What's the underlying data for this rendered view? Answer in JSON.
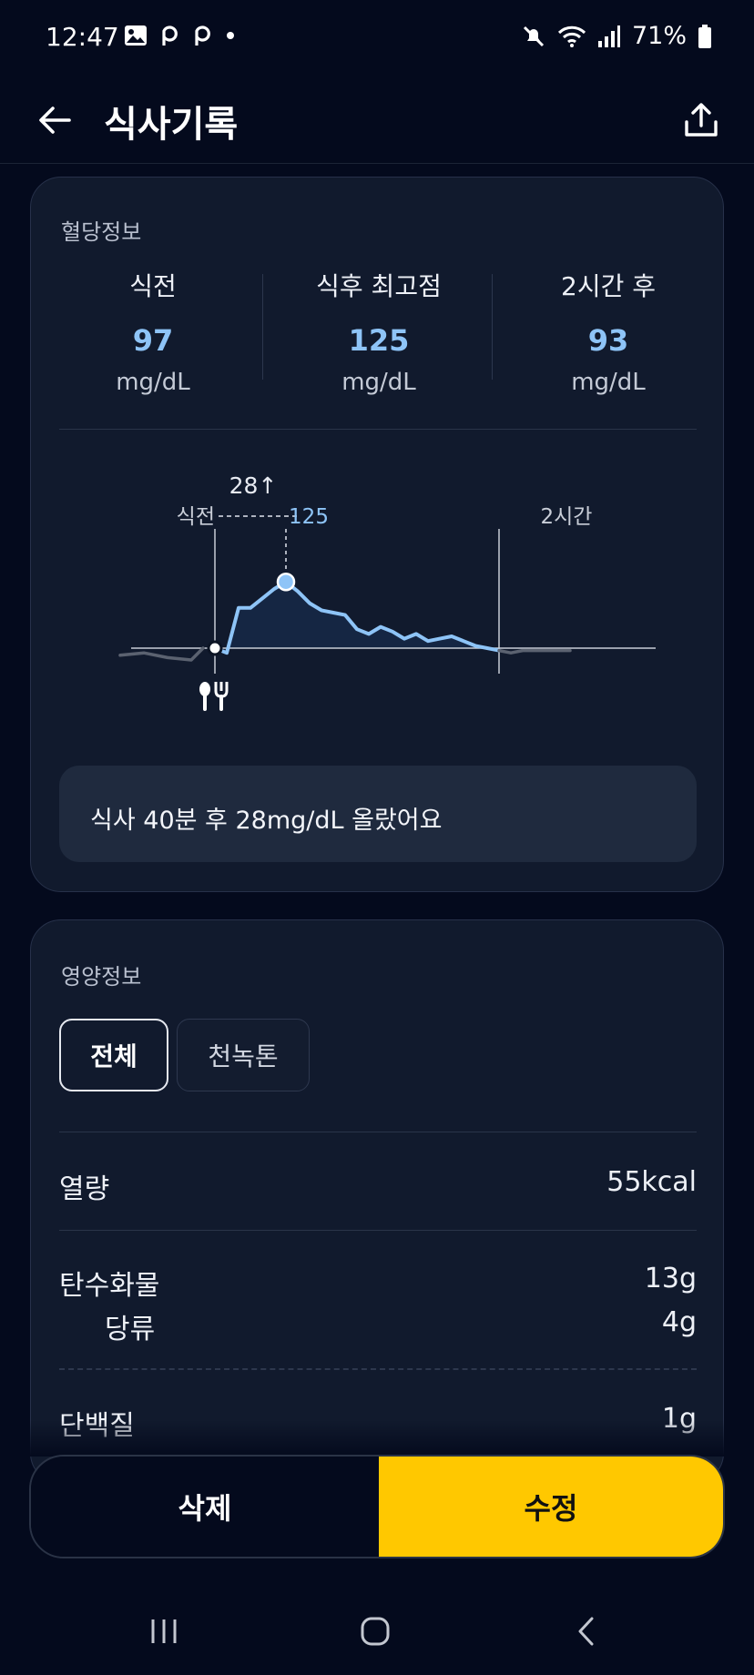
{
  "status_bar": {
    "time": "12:47",
    "battery": "71%",
    "left_icons": [
      "gallery-icon",
      "p-notification-icon",
      "p-notification-icon",
      "dot-icon"
    ],
    "right_icons": [
      "mute-icon",
      "wifi-icon",
      "signal-icon",
      "battery-icon"
    ]
  },
  "header": {
    "title": "식사기록",
    "back_icon": "arrow-left-icon",
    "share_icon": "share-icon"
  },
  "glucose": {
    "section_title": "혈당정보",
    "stats": [
      {
        "label": "식전",
        "value": "97",
        "unit": "mg/dL"
      },
      {
        "label": "식후 최고점",
        "value": "125",
        "unit": "mg/dL"
      },
      {
        "label": "2시간 후",
        "value": "93",
        "unit": "mg/dL"
      }
    ],
    "chart_labels": {
      "before_meal": "식전",
      "rise": "28↑",
      "peak_value": "125",
      "two_hours": "2시간"
    },
    "insight": "식사 40분 후 28mg/dL 올랐어요"
  },
  "chart_data": {
    "type": "line",
    "series": [
      {
        "points": [
          [
            -40,
            94
          ],
          [
            -30,
            95
          ],
          [
            -20,
            93
          ],
          [
            -10,
            92
          ],
          [
            -5,
            97
          ]
        ]
      },
      {
        "points": [
          [
            0,
            97
          ],
          [
            5,
            95
          ],
          [
            10,
            114
          ],
          [
            15,
            114
          ],
          [
            20,
            118
          ],
          [
            25,
            122
          ],
          [
            30,
            125
          ],
          [
            35,
            121
          ],
          [
            40,
            116
          ],
          [
            45,
            113
          ],
          [
            50,
            112
          ],
          [
            55,
            111
          ],
          [
            60,
            105
          ],
          [
            65,
            103
          ],
          [
            70,
            106
          ],
          [
            75,
            104
          ],
          [
            80,
            101
          ],
          [
            85,
            103
          ],
          [
            90,
            100
          ],
          [
            95,
            101
          ],
          [
            100,
            102
          ],
          [
            105,
            100
          ],
          [
            110,
            98
          ],
          [
            115,
            97
          ],
          [
            120,
            96
          ]
        ]
      },
      {
        "points": [
          [
            120,
            96
          ],
          [
            125,
            95
          ],
          [
            130,
            96
          ],
          [
            140,
            96
          ],
          [
            150,
            96
          ]
        ]
      }
    ],
    "markers": [
      {
        "label": "식전",
        "x": 0,
        "y": 97
      },
      {
        "label": "125",
        "x": 30,
        "y": 125
      }
    ],
    "vertical_lines": [
      0,
      120
    ],
    "baseline": 97,
    "annotation": "28↑",
    "xlabel": "",
    "ylabel": "",
    "colors": {
      "line": "#8ec4f7",
      "area": "#162846",
      "outside": "#5b6270",
      "baseline": "#c8cdd7"
    }
  },
  "nutrition": {
    "section_title": "영양정보",
    "tabs": [
      "전체",
      "천녹톤"
    ],
    "active_tab": "전체",
    "calories": {
      "label": "열량",
      "value": "55kcal"
    },
    "carbs": {
      "label": "탄수화물",
      "value": "13g"
    },
    "sugar": {
      "label": "당류",
      "value": "4g"
    },
    "protein": {
      "label": "단백질",
      "value": "1g"
    }
  },
  "actions": {
    "delete": "삭제",
    "edit": "수정"
  },
  "colors": {
    "background": "#040a1d",
    "card": "#111a2d",
    "accent_blue": "#8ec4f7",
    "accent_yellow": "#ffc800"
  },
  "nav": {
    "icons": [
      "recent-apps-icon",
      "home-icon",
      "back-nav-icon"
    ]
  }
}
